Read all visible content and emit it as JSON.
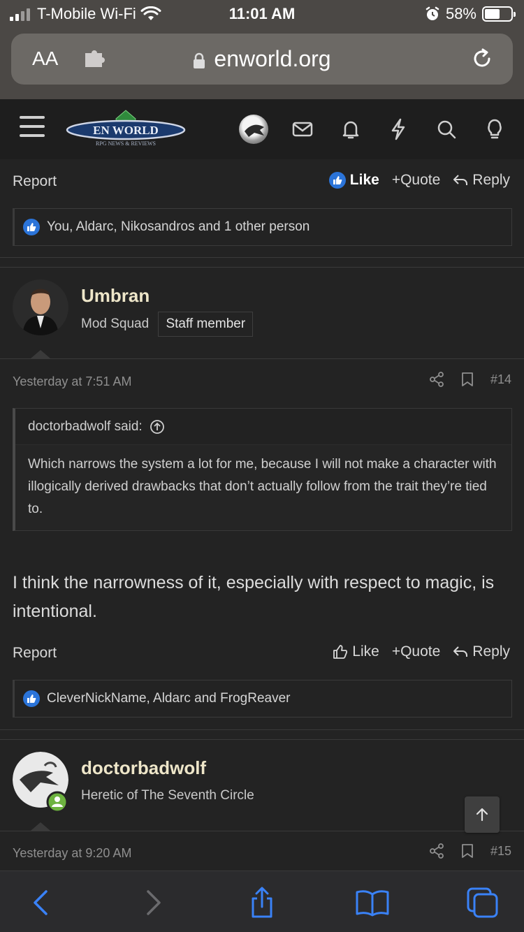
{
  "status_bar": {
    "carrier": "T-Mobile Wi-Fi",
    "time": "11:01 AM",
    "battery_percent_label": "58%",
    "battery_level": 0.58
  },
  "browser": {
    "text_size_label": "AA",
    "url": "enworld.org"
  },
  "site_header": {
    "logo_text": "EN WORLD",
    "logo_tagline": "RPG NEWS & REVIEWS"
  },
  "post_13_footer": {
    "report": "Report",
    "like": "Like",
    "quote": "+Quote",
    "reply": "Reply",
    "reactions_text": "You, Aldarc, Nikosandros and 1 other person"
  },
  "post_14": {
    "author": "Umbran",
    "user_title": "Mod Squad",
    "badge": "Staff member",
    "date": "Yesterday at 7:51 AM",
    "number": "#14",
    "quote_author": "doctorbadwolf said:",
    "quote_text": "Which narrows the system a lot for me, because I will not make a character with illogically derived drawbacks that don’t actually follow from the trait they’re tied to.",
    "body": "I think the narrowness of it, especially with respect to magic, is intentional.",
    "report": "Report",
    "like": "Like",
    "quote": "+Quote",
    "reply": "Reply",
    "reactions_text": "CleverNickName, Aldarc and FrogReaver"
  },
  "post_15": {
    "author": "doctorbadwolf",
    "user_title": "Heretic of The Seventh Circle",
    "date": "Yesterday at 9:20 AM",
    "number": "#15"
  },
  "colors": {
    "background": "#232323",
    "author_name": "#eee6c9",
    "like_blue": "#2b74d9",
    "online_green": "#6db33f",
    "safari_blue": "#3a82f7"
  }
}
